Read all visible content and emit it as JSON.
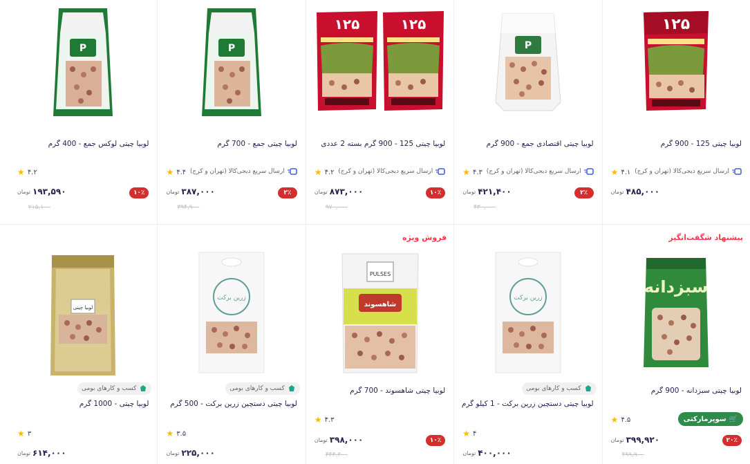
{
  "toman_label": "تومان",
  "colors": {
    "discount": "#d32f2f",
    "special": "#ef394e",
    "star": "#f9bc00",
    "super": "#2e8b4a",
    "ship_icon": "#3b5bdb"
  },
  "row1": [
    {
      "title": "لوبیا چیتی 125 - 900 گرم",
      "shipping": "ارسال سریع دیجی‌کالا (تهران و کرج)",
      "rating": "۴.۱",
      "discount": "",
      "price": "۴۸۵,۰۰۰",
      "old_price": "",
      "image": "food-products-bag"
    },
    {
      "title": "لوبیا چیتی اقتصادی جمع - 900 گرم",
      "shipping": "ارسال سریع دیجی‌کالا (تهران و کرج)",
      "rating": "۴.۳",
      "discount": "۲٪",
      "price": "۴۲۱,۴۰۰",
      "old_price": "۴۳۰,۰۰۰",
      "image": "jam-clear-bag"
    },
    {
      "title": "لوبیا چیتی 125 - 900 گرم بسته 2 عددی",
      "shipping": "ارسال سریع دیجی‌کالا (تهران و کرج)",
      "rating": "۴.۲",
      "discount": "۱۰٪",
      "price": "۸۷۳,۰۰۰",
      "old_price": "۹۷۰,۰۰۰",
      "image": "food-products-double"
    },
    {
      "title": "لوبیا چیتی جمع - 700 گرم",
      "shipping": "ارسال سریع دیجی‌کالا (تهران و کرج)",
      "rating": "۴.۴",
      "discount": "۲٪",
      "price": "۳۸۷,۰۰۰",
      "old_price": "۳۹۴,۹۰۰",
      "image": "jam-green-bag"
    },
    {
      "title": "لوبیا چیتی لوکس جمع - 400 گرم",
      "shipping": "",
      "rating": "۴.۲",
      "discount": "۱۰٪",
      "price": "۱۹۳,۵۹۰",
      "old_price": "۲۱۵,۱۰۰",
      "image": "jam-green-bag"
    }
  ],
  "row2": [
    {
      "special": "پیشنهاد شگفت‌انگیز",
      "chip": "",
      "super": "سوپرمارکتی",
      "title": "لوبیا چیتی سبزدانه - 900 گرم",
      "rating": "۴.۵",
      "discount": "۲۰٪",
      "price": "۳۹۹,۹۲۰",
      "old_price": "۴۹۹,۹۰۰",
      "image": "sabzdaneh-bag"
    },
    {
      "special": "",
      "chip": "کسب و کارهای بومی",
      "super": "",
      "title": "لوبیا چیتی دستچین زرین برکت - 1 کیلو گرم",
      "rating": "۴",
      "discount": "",
      "price": "۴۰۰,۰۰۰",
      "old_price": "",
      "image": "white-pouch"
    },
    {
      "special": "فروش ویژه",
      "chip": "",
      "super": "",
      "title": "لوبیا چیتی شاهسوند - 700 گرم",
      "rating": "۴.۳",
      "discount": "۱۰٪",
      "price": "۳۹۸,۰۰۰",
      "old_price": "۴۴۳,۳۰۰",
      "image": "shahsavand-bag"
    },
    {
      "special": "",
      "chip": "کسب و کارهای بومی",
      "super": "",
      "title": "لوبیا چیتی دستچین زرین برکت - 500 گرم",
      "rating": "۳.۵",
      "discount": "",
      "price": "۲۲۵,۰۰۰",
      "old_price": "",
      "image": "white-pouch"
    },
    {
      "special": "",
      "chip": "کسب و کارهای بومی",
      "super": "",
      "title": "لوبیا چیتی - 1000 گرم",
      "rating": "۳",
      "discount": "",
      "price": "۶۱۴,۰۰۰",
      "old_price": "",
      "image": "gold-pouch"
    }
  ]
}
